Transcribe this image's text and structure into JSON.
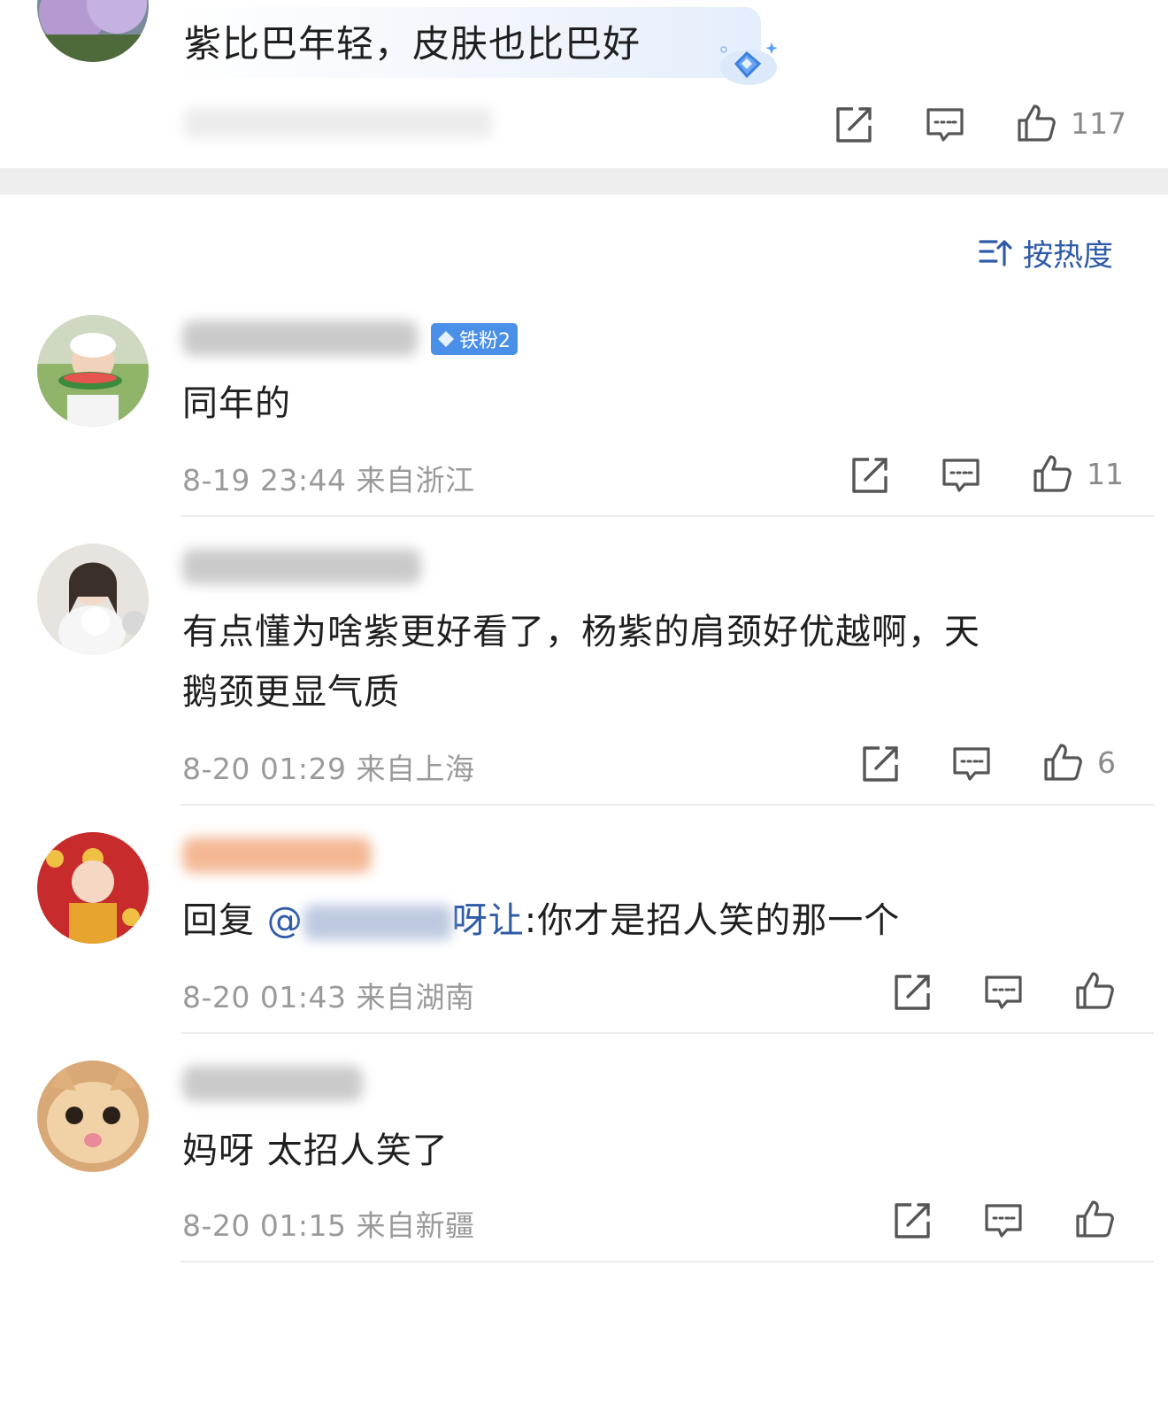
{
  "top_comment": {
    "text": "紫比巴年轻，皮肤也比巴好",
    "like_count": "117",
    "colors": {
      "bubble": "#eef3fb",
      "badge": "#5aa0ff"
    }
  },
  "sort_label": "按热度",
  "comments": [
    {
      "badge": "铁粉2",
      "text": "同年的",
      "time": "8-19 23:44",
      "location": "来自浙江",
      "like_count": "11"
    },
    {
      "text_line1": "有点懂为啥紫更好看了，杨紫的肩颈好优越啊，天",
      "text_line2": "鹅颈更显气质",
      "time": "8-20 01:29",
      "location": "来自上海",
      "like_count": "6"
    },
    {
      "reply_prefix": "回复",
      "mention_suffix": "呀让",
      "reply_text": ":你才是招人笑的那一个",
      "time": "8-20 01:43",
      "location": "来自湖南",
      "like_count": ""
    },
    {
      "text": "妈呀 太招人笑了",
      "time": "8-20 01:15",
      "location": "来自新疆",
      "like_count": ""
    }
  ],
  "icons": [
    "share-icon",
    "comment-icon",
    "like-icon",
    "sort-icon",
    "diamond-icon"
  ],
  "colors": {
    "accent": "#2e5aa8",
    "badge_bg": "#4a90e8",
    "divider": "#ececec",
    "gray_text": "#9a9a9a"
  }
}
